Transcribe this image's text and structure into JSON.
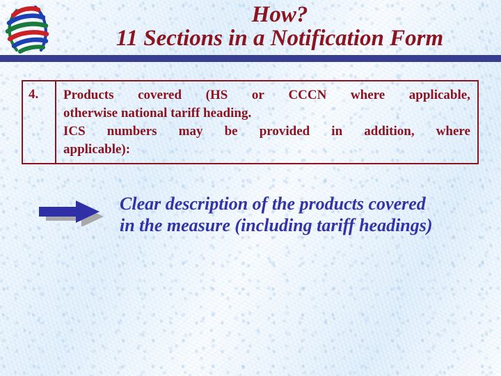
{
  "slide": {
    "background_color": "#e2f0fc",
    "accent_red": "#8c1420",
    "accent_blue": "#3333a8",
    "rule_color": "#383e8f"
  },
  "logo": {
    "name": "WTO globe logo",
    "arc_colors": [
      "#cc2027",
      "#1f3fb5",
      "#1a7a3c"
    ]
  },
  "header": {
    "title_line1": "How?",
    "title_line2": "11 Sections in a Notification Form"
  },
  "notification_item": {
    "number": "4.",
    "lines": [
      [
        "Products",
        "covered",
        "(HS",
        "or",
        "CCCN",
        "where",
        "applicable,"
      ],
      [
        "otherwise national tariff heading."
      ],
      [
        "ICS",
        "numbers",
        "may",
        "be",
        "provided",
        "in",
        "addition,",
        "where"
      ],
      [
        "applicable):"
      ]
    ],
    "full_text": "Products covered (HS or CCCN where applicable, otherwise national tariff heading. ICS numbers may be provided in addition, where applicable):"
  },
  "callout": {
    "arrow": "right-arrow",
    "arrow_fill": "#2f2fa8",
    "arrow_shadow": "#a8a8a8",
    "line1": "Clear description of the products covered",
    "line2": "in the measure (including tariff headings)"
  }
}
